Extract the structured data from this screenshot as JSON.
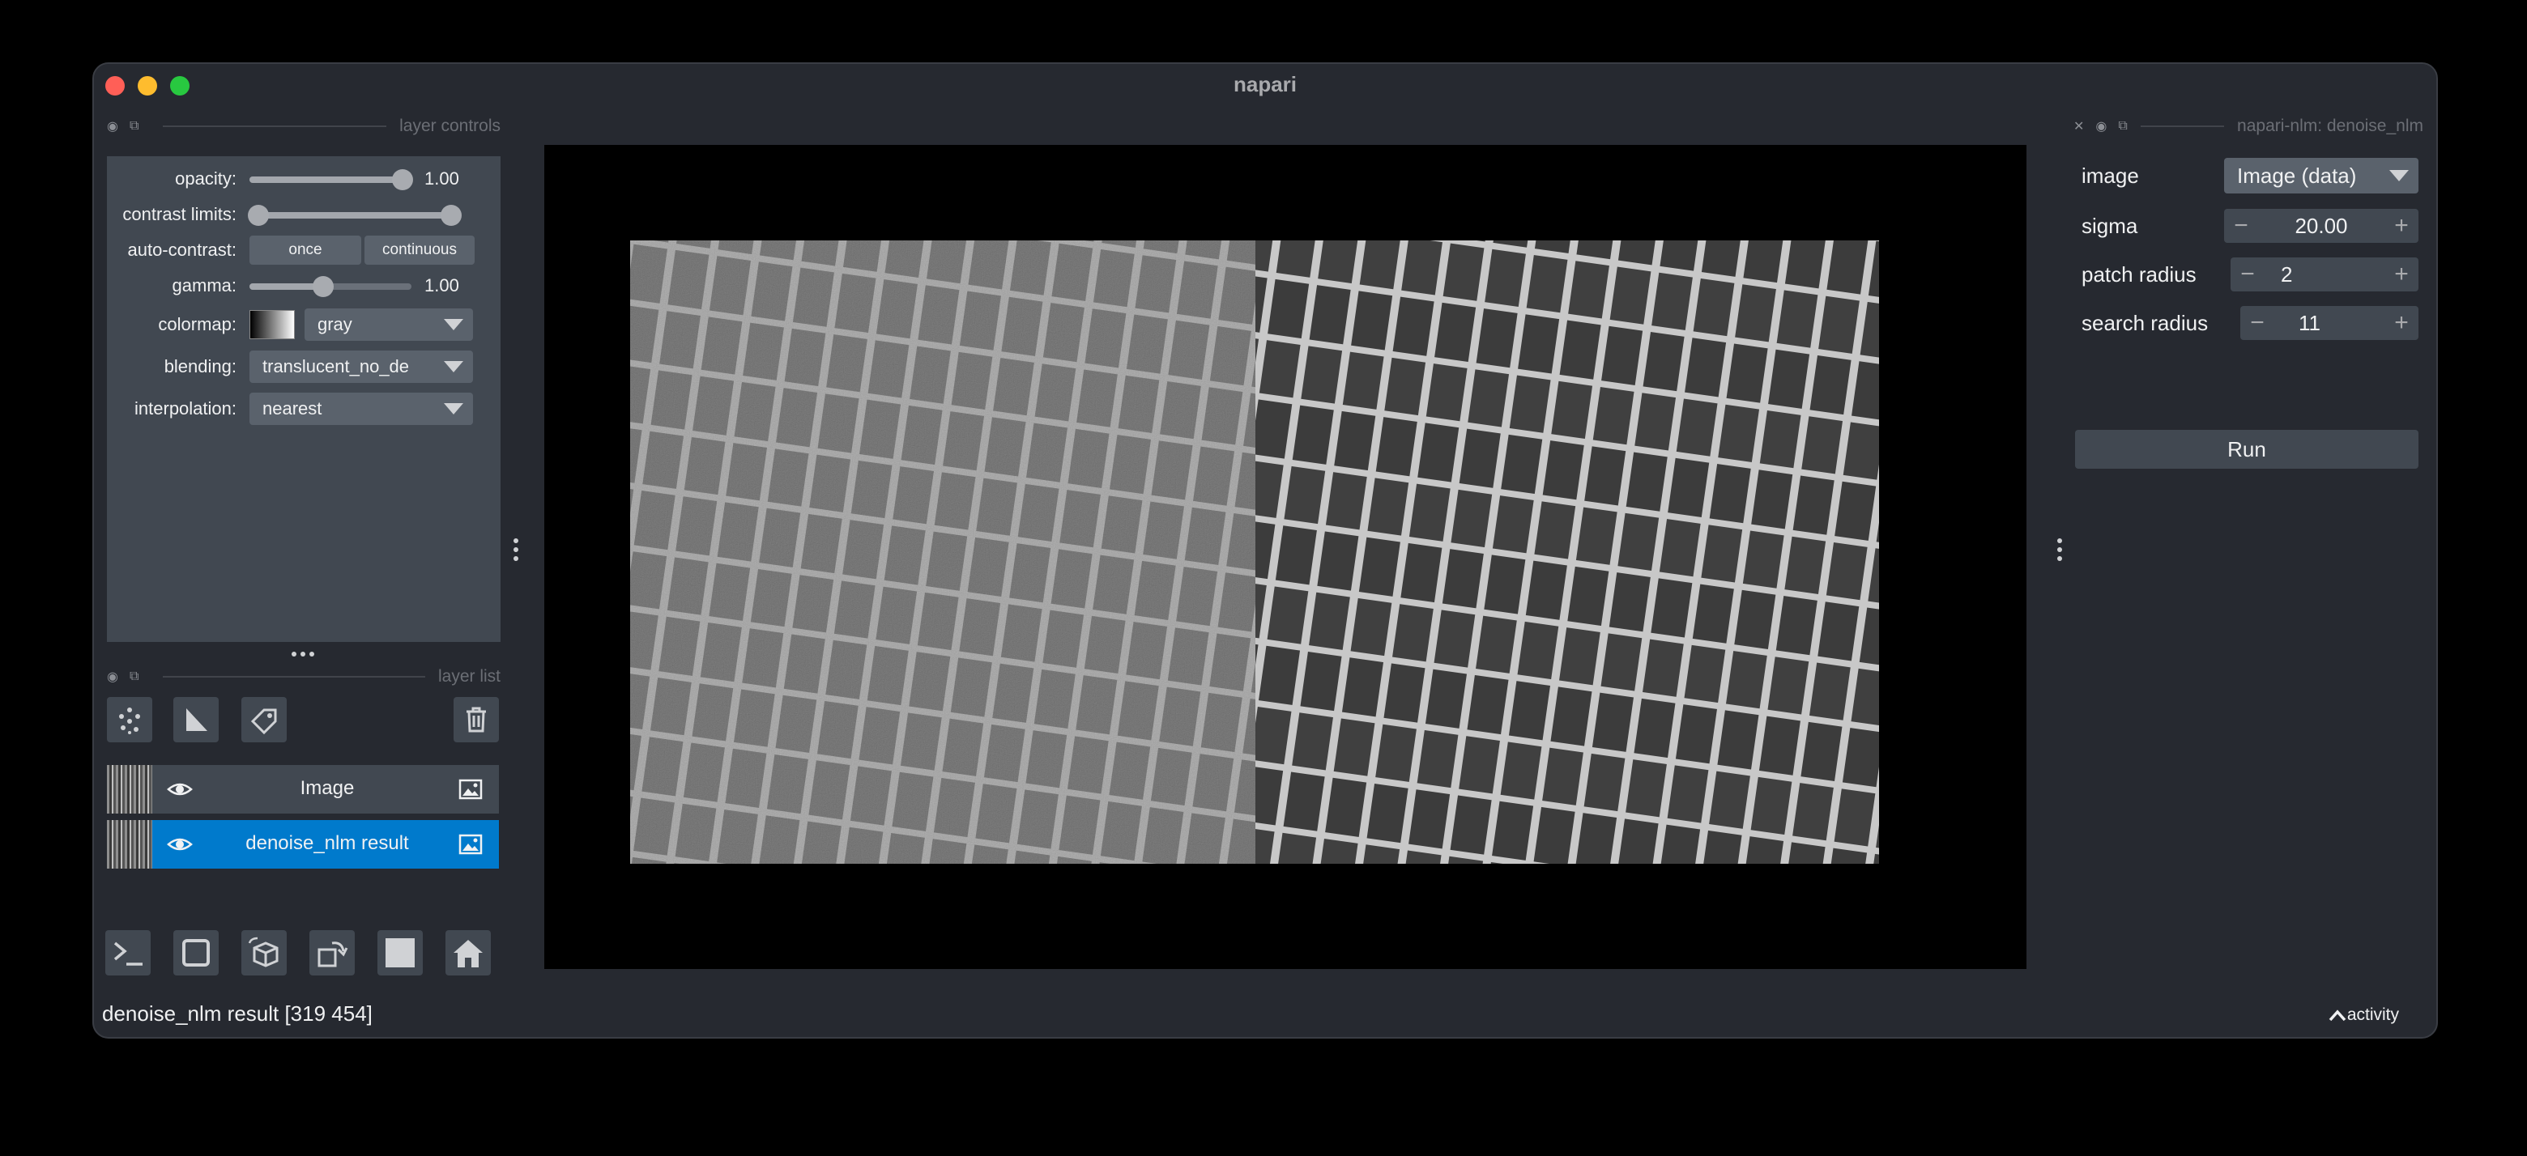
{
  "window": {
    "title": "napari"
  },
  "layer_controls": {
    "header": "layer controls",
    "opacity": {
      "label": "opacity:",
      "value": "1.00",
      "level": 1.0
    },
    "contrast_limits": {
      "label": "contrast limits:",
      "low": 0.0,
      "high": 1.0
    },
    "auto_contrast": {
      "label": "auto-contrast:",
      "once": "once",
      "continuous": "continuous"
    },
    "gamma": {
      "label": "gamma:",
      "value": "1.00",
      "level": 0.5
    },
    "colormap": {
      "label": "colormap:",
      "value": "gray"
    },
    "blending": {
      "label": "blending:",
      "value": "translucent_no_de"
    },
    "interpolation": {
      "label": "interpolation:",
      "value": "nearest"
    }
  },
  "layer_list": {
    "header": "layer list",
    "layers": [
      {
        "name": "Image",
        "selected": false
      },
      {
        "name": "denoise_nlm result",
        "selected": true
      }
    ]
  },
  "widget": {
    "header": "napari-nlm: denoise_nlm",
    "image": {
      "label": "image",
      "value": "Image (data)"
    },
    "sigma": {
      "label": "sigma",
      "value": "20.00"
    },
    "patch_radius": {
      "label": "patch radius",
      "value": "2"
    },
    "search_radius": {
      "label": "search radius",
      "value": "11"
    },
    "run": "Run"
  },
  "status": {
    "text": "denoise_nlm result [319 454]",
    "activity": "activity"
  },
  "colors": {
    "accent": "#007acc",
    "background": "#262930",
    "panel": "#414851"
  }
}
